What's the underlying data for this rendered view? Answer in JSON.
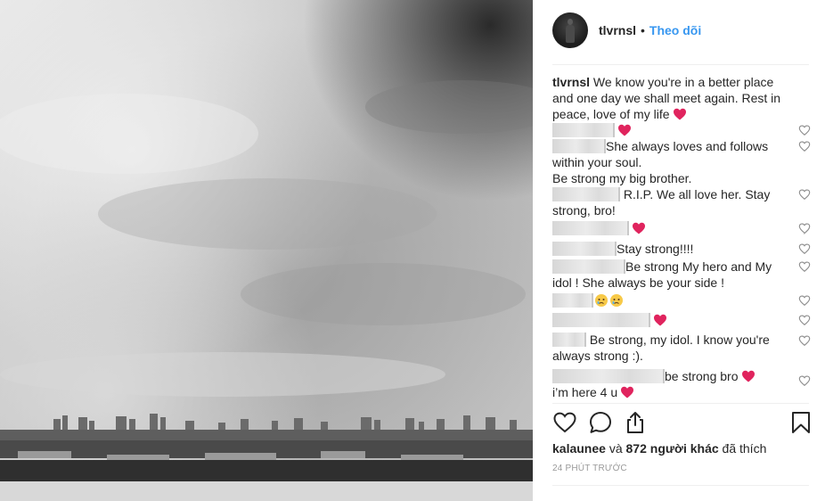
{
  "post": {
    "username": "tlvrnsl",
    "separator": "•",
    "follow_label": "Theo dõi",
    "caption": "We know you're in a better place and one day we shall meet again. Rest in peace, love of my life"
  },
  "comments": [
    {
      "lines": [
        "",
        ""
      ],
      "emoji": "heart"
    },
    {
      "lines": [
        "She always loves and follows",
        "within your soul.",
        "Be strong my big brother."
      ]
    },
    {
      "lines": [
        "R.I.P. We all love her. Stay",
        "strong, bro!"
      ]
    },
    {
      "lines": [
        ""
      ],
      "emoji": "heart"
    },
    {
      "lines": [
        "Stay strong!!!!"
      ]
    },
    {
      "lines": [
        "Be strong My hero and My",
        "idol ! She always be your side !"
      ]
    },
    {
      "lines": [
        ""
      ],
      "emoji": "crying"
    },
    {
      "lines": [
        ""
      ],
      "emoji": "heart"
    },
    {
      "lines": [
        " Be strong, my idol. I know you're",
        "always strong :)."
      ]
    },
    {
      "lines": [
        "be strong bro",
        "i'm here 4 u"
      ],
      "emoji": "heart"
    }
  ],
  "caption_lines": [
    "We know you're in a better place",
    "and one day we shall meet again. Rest in",
    "peace, love of my life"
  ],
  "comment_text": {
    "c2a": "She always loves and follows",
    "c2b": "within your soul.",
    "c2c": "Be strong my big brother.",
    "c3a": "R.I.P. We all love her. Stay",
    "c3b": "strong, bro!",
    "c5": "Stay strong!!!!",
    "c6a": "Be strong My hero and My",
    "c6b": "idol ! She always be your side !",
    "c9a": " Be strong, my idol. I know you're",
    "c9b": "always strong :).",
    "c10a": "be strong bro",
    "c10b": "i’m here 4 u"
  },
  "actions": {
    "icons": [
      "heart-outline-icon",
      "comment-icon",
      "share-icon",
      "bookmark-icon"
    ]
  },
  "likes": {
    "first_user": "kalaunee",
    "and": "và",
    "count_text": "872 người khác",
    "suffix": "đã thích"
  },
  "timestamp": "24 PHÚT TRƯỚC",
  "colors": {
    "accent": "#3897f0",
    "heart_emoji": "#e0245e",
    "text": "#262626",
    "muted": "#999999",
    "divider": "#efefef"
  }
}
